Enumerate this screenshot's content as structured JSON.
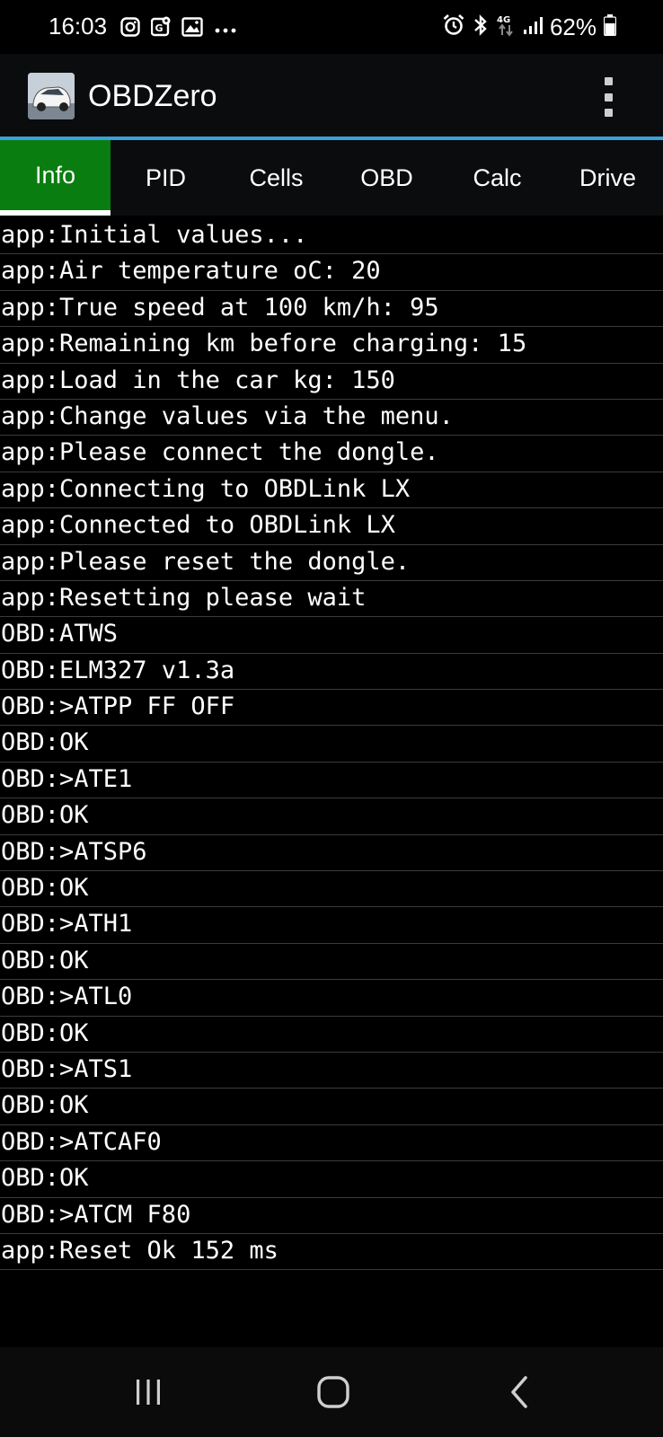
{
  "status_bar": {
    "time": "16:03",
    "battery_text": "62%",
    "left_icons": [
      "instagram-icon",
      "maps-icon",
      "gallery-icon",
      "more-dots-icon"
    ],
    "right_icons": [
      "alarm-icon",
      "bluetooth-icon",
      "4g-data-icon",
      "signal-icon",
      "battery-icon"
    ]
  },
  "app_bar": {
    "title": "OBDZero",
    "icon": "car-app-icon",
    "menu_icon": "overflow-menu-icon"
  },
  "tabs": [
    {
      "label": "Info",
      "active": true
    },
    {
      "label": "PID",
      "active": false
    },
    {
      "label": "Cells",
      "active": false
    },
    {
      "label": "OBD",
      "active": false
    },
    {
      "label": "Calc",
      "active": false
    },
    {
      "label": "Drive",
      "active": false
    }
  ],
  "log": [
    "app:Initial values...",
    "app:Air temperature oC: 20",
    "app:True speed at 100 km/h: 95",
    "app:Remaining km before charging: 15",
    "app:Load in the car kg: 150",
    "app:Change values via the menu.",
    "app:Please connect the dongle.",
    "app:Connecting to OBDLink LX",
    "app:Connected to OBDLink LX",
    "app:Please reset the dongle.",
    "app:Resetting please wait",
    "OBD:ATWS",
    "OBD:ELM327 v1.3a",
    "OBD:>ATPP FF OFF",
    "OBD:OK",
    "OBD:>ATE1",
    "OBD:OK",
    "OBD:>ATSP6",
    "OBD:OK",
    "OBD:>ATH1",
    "OBD:OK",
    "OBD:>ATL0",
    "OBD:OK",
    "OBD:>ATS1",
    "OBD:OK",
    "OBD:>ATCAF0",
    "OBD:OK",
    "OBD:>ATCM F80",
    "app:Reset Ok 152 ms"
  ],
  "nav_bar": {
    "buttons": [
      "recent-apps-icon",
      "home-icon",
      "back-icon"
    ]
  },
  "colors": {
    "accent_line": "#3aa0d8",
    "active_tab": "#0a7d10",
    "background": "#000000"
  }
}
